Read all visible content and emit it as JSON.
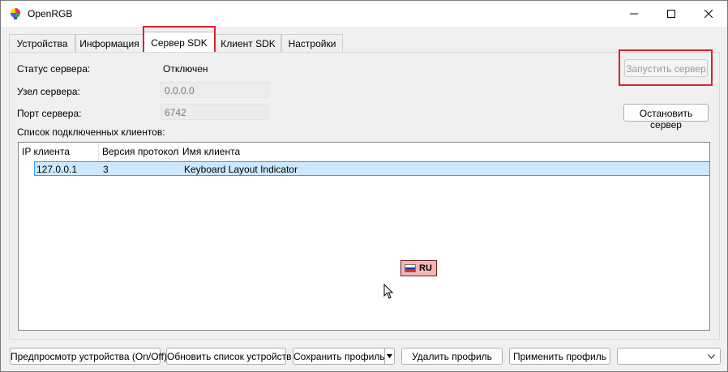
{
  "window": {
    "title": "OpenRGB",
    "controls": {
      "minimize_icon": "minimize-icon",
      "maximize_icon": "maximize-icon",
      "close_icon": "close-icon"
    }
  },
  "tabs": [
    {
      "label": "Устройства",
      "active": false
    },
    {
      "label": "Информация",
      "active": false
    },
    {
      "label": "Сервер SDK",
      "active": true
    },
    {
      "label": "Клиент SDK",
      "active": false
    },
    {
      "label": "Настройки",
      "active": false
    }
  ],
  "server": {
    "status_label": "Статус сервера:",
    "status_value": "Отключен",
    "host_label": "Узел сервера:",
    "host_value": "0.0.0.0",
    "port_label": "Порт сервера:",
    "port_value": "6742",
    "start_button": "Запустить сервер",
    "stop_button": "Остановить сервер",
    "clients_label": "Список подключенных клиентов:"
  },
  "clients_table": {
    "columns": [
      "IP клиента",
      "Версия протоколa",
      "Имя клиента"
    ],
    "rows": [
      {
        "ip": "127.0.0.1",
        "protocol": "3",
        "name": "Keyboard Layout Indicator",
        "selected": true
      }
    ]
  },
  "language_indicator": {
    "code": "RU",
    "flag_colors": [
      "#ffffff",
      "#0039a6",
      "#d52b1e"
    ]
  },
  "bottom_bar": {
    "preview_button": "Предпросмотр устройства (On/Off)",
    "refresh_button": "Обновить список устройств",
    "save_profile_button": "Сохранить профиль",
    "delete_profile_button": "Удалить профиль",
    "apply_profile_button": "Применить профиль",
    "profile_select_value": ""
  },
  "colors": {
    "highlight": "#e0202a",
    "selection": "#cce8ff",
    "selection_border": "#3399ff"
  }
}
